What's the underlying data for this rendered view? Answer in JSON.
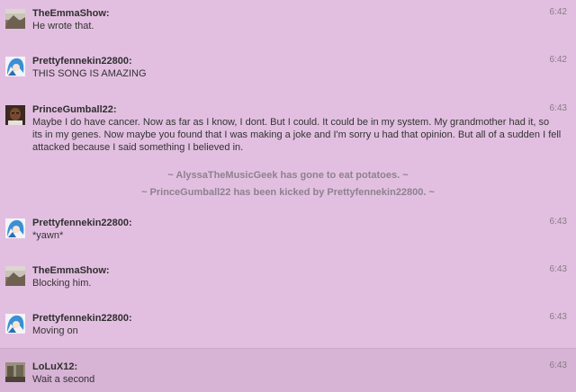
{
  "messages": [
    {
      "user": "TheEmmaShow:",
      "text": "He wrote that.",
      "time": "6:42",
      "avatar": "landscape-avatar-icon"
    },
    {
      "user": "Prettyfennekin22800:",
      "text": "THIS SONG IS AMAZING",
      "time": "6:42",
      "avatar": "blue-hair-avatar-icon"
    },
    {
      "user": "PrinceGumball22:",
      "text": "Maybe I do have cancer. Now as far as I know, I dont. But I could. It could be in my system. My grandmother had it, so its in my genes. Now maybe you found that I was making a joke and I'm sorry u had that opinion. But all of a sudden I fell attacked because I said something I believed in.",
      "time": "6:43",
      "avatar": "portrait-avatar-icon"
    },
    {
      "user": "Prettyfennekin22800:",
      "text": "*yawn*",
      "time": "6:43",
      "avatar": "blue-hair-avatar-icon"
    },
    {
      "user": "TheEmmaShow:",
      "text": "Blocking him.",
      "time": "6:43",
      "avatar": "landscape-avatar-icon"
    },
    {
      "user": "Prettyfennekin22800:",
      "text": "Moving on",
      "time": "6:43",
      "avatar": "blue-hair-avatar-icon"
    },
    {
      "user": "LoLuX12:",
      "text": "Wait a second",
      "time": "6:43",
      "avatar": "photo-avatar-icon"
    }
  ],
  "system_messages": [
    "~ AlyssaTheMusicGeek has gone to eat potatoes. ~",
    "~ PrinceGumball22 has been kicked by Prettyfennekin22800. ~"
  ],
  "colors": {
    "background": "#e2bfe0",
    "highlight_row": "#d7b3d5",
    "system_text": "#8d8290",
    "timestamp": "#8a7a88"
  }
}
